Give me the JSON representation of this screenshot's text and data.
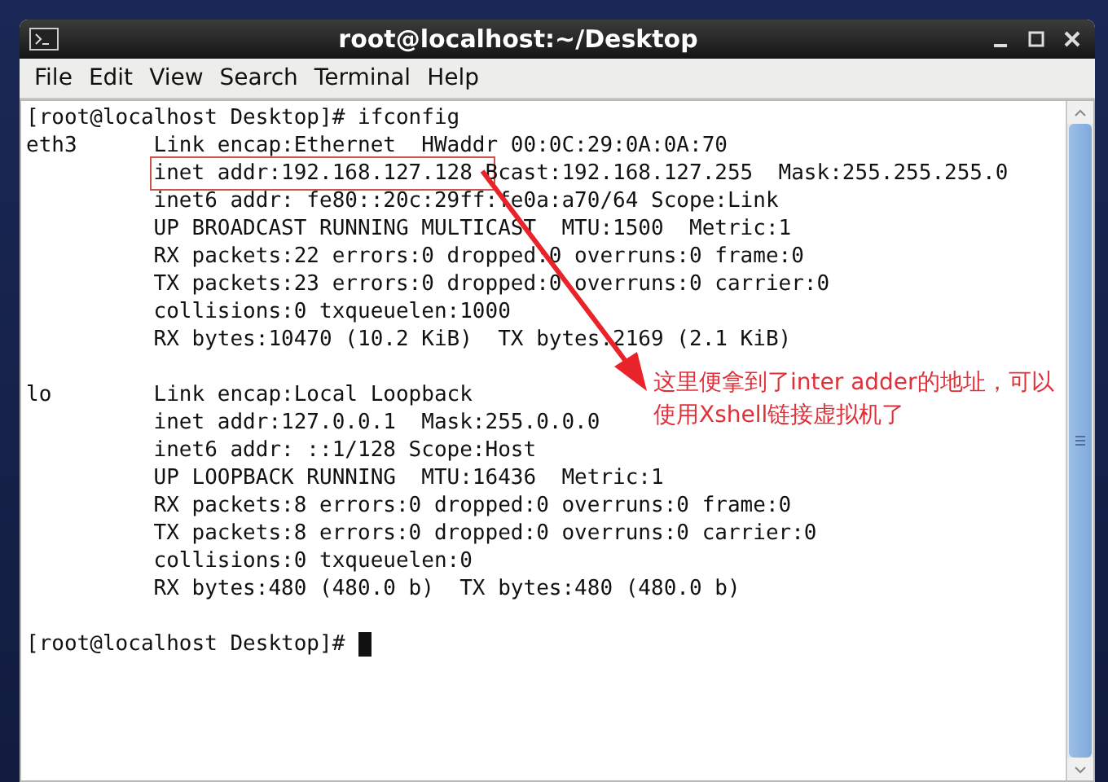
{
  "window": {
    "title": "root@localhost:~/Desktop"
  },
  "menu": [
    "File",
    "Edit",
    "View",
    "Search",
    "Terminal",
    "Help"
  ],
  "terminal": {
    "blocks": [
      [
        {
          "kind": "plain",
          "text": "[root@localhost Desktop]# ifconfig"
        },
        {
          "kind": "plain",
          "text": "eth3      Link encap:Ethernet  HWaddr 00:0C:29:0A:0A:70"
        },
        {
          "kind": "boxed",
          "boxed": "inet addr:192.168.127.128",
          "after": " Bcast:192.168.127.255  Mask:255.255.255.0"
        },
        {
          "kind": "plain",
          "text": "          inet6 addr: fe80::20c:29ff:fe0a:a70/64 Scope:Link"
        },
        {
          "kind": "plain",
          "text": "          UP BROADCAST RUNNING MULTICAST  MTU:1500  Metric:1"
        },
        {
          "kind": "plain",
          "text": "          RX packets:22 errors:0 dropped:0 overruns:0 frame:0"
        },
        {
          "kind": "plain",
          "text": "          TX packets:23 errors:0 dropped:0 overruns:0 carrier:0"
        },
        {
          "kind": "plain",
          "text": "          collisions:0 txqueuelen:1000"
        },
        {
          "kind": "plain",
          "text": "          RX bytes:10470 (10.2 KiB)  TX bytes:2169 (2.1 KiB)"
        }
      ],
      [
        {
          "kind": "plain",
          "text": "lo        Link encap:Local Loopback"
        },
        {
          "kind": "plain",
          "text": "          inet addr:127.0.0.1  Mask:255.0.0.0"
        },
        {
          "kind": "plain",
          "text": "          inet6 addr: ::1/128 Scope:Host"
        },
        {
          "kind": "plain",
          "text": "          UP LOOPBACK RUNNING  MTU:16436  Metric:1"
        },
        {
          "kind": "plain",
          "text": "          RX packets:8 errors:0 dropped:0 overruns:0 frame:0"
        },
        {
          "kind": "plain",
          "text": "          TX packets:8 errors:0 dropped:0 overruns:0 carrier:0"
        },
        {
          "kind": "plain",
          "text": "          collisions:0 txqueuelen:0"
        },
        {
          "kind": "plain",
          "text": "          RX bytes:480 (480.0 b)  TX bytes:480 (480.0 b)"
        }
      ],
      [
        {
          "kind": "prompt",
          "text": "[root@localhost Desktop]# "
        }
      ]
    ],
    "cursor_visible": true
  },
  "annotation": {
    "note": "这里便拿到了inter adder的地址，可以使用Xshell链接虚拟机了"
  }
}
